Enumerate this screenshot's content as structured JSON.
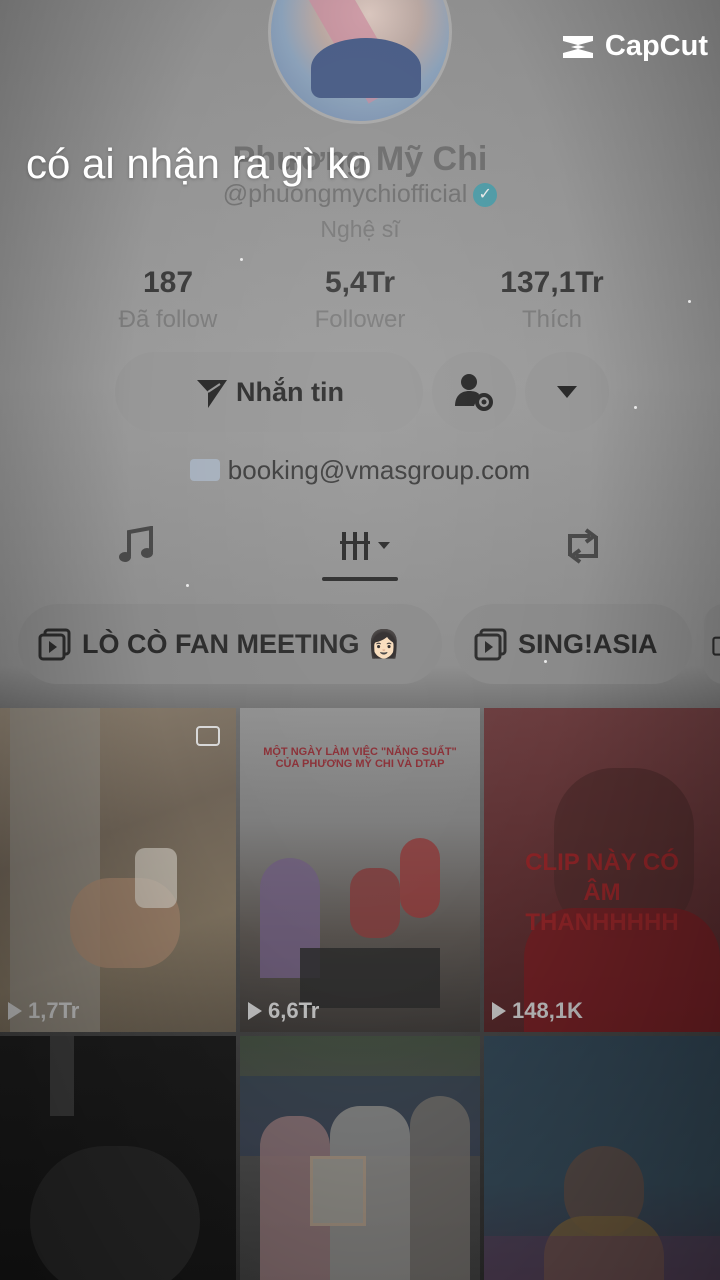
{
  "overlay": {
    "caption": "có ai nhận ra gì ko",
    "brand": "CapCut"
  },
  "profile": {
    "name": "Phương Mỹ Chi",
    "handle": "@phuongmychiofficial",
    "role": "Nghệ sĩ",
    "stats": [
      {
        "value": "187",
        "label": "Đã follow"
      },
      {
        "value": "5,4Tr",
        "label": "Follower"
      },
      {
        "value": "137,1Tr",
        "label": "Thích"
      }
    ],
    "message_button": "Nhắn tin",
    "email": "booking@vmasgroup.com"
  },
  "playlists": [
    {
      "label": "LÒ CÒ FAN MEETING 👩🏻"
    },
    {
      "label": "SING!ASIA"
    }
  ],
  "videos": [
    {
      "views": "1,7Tr",
      "caption": ""
    },
    {
      "views": "6,6Tr",
      "caption": "MỘT NGÀY LÀM VIỆC \"NĂNG SUẤT\" CỦA PHƯƠNG MỸ CHI VÀ DTAP"
    },
    {
      "views": "148,1K",
      "caption": "CLIP NÀY CÓ ÂM THANHHHHH"
    },
    {
      "views": "",
      "caption": ""
    },
    {
      "views": "",
      "caption": ""
    },
    {
      "views": "",
      "caption": ""
    }
  ],
  "colors": {
    "verified": "#4f9ba6",
    "overlay_text": "#ffffff"
  }
}
